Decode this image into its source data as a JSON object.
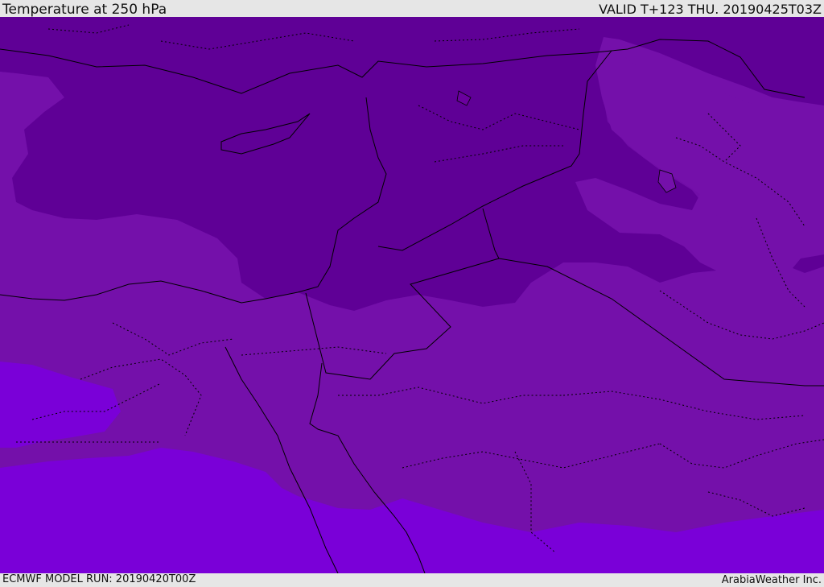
{
  "header": {
    "title": "Temperature at 250 hPa",
    "valid": "VALID T+123 THU. 20190425T03Z"
  },
  "footer": {
    "model_run": "ECMWF MODEL RUN: 20190420T00Z",
    "credit": "ArabiaWeather Inc."
  },
  "map": {
    "colors": {
      "coldest": "#5f0096",
      "cold": "#6a009e",
      "mid": "#7410aa",
      "warm": "#7a00d8",
      "border": "#000000"
    }
  }
}
